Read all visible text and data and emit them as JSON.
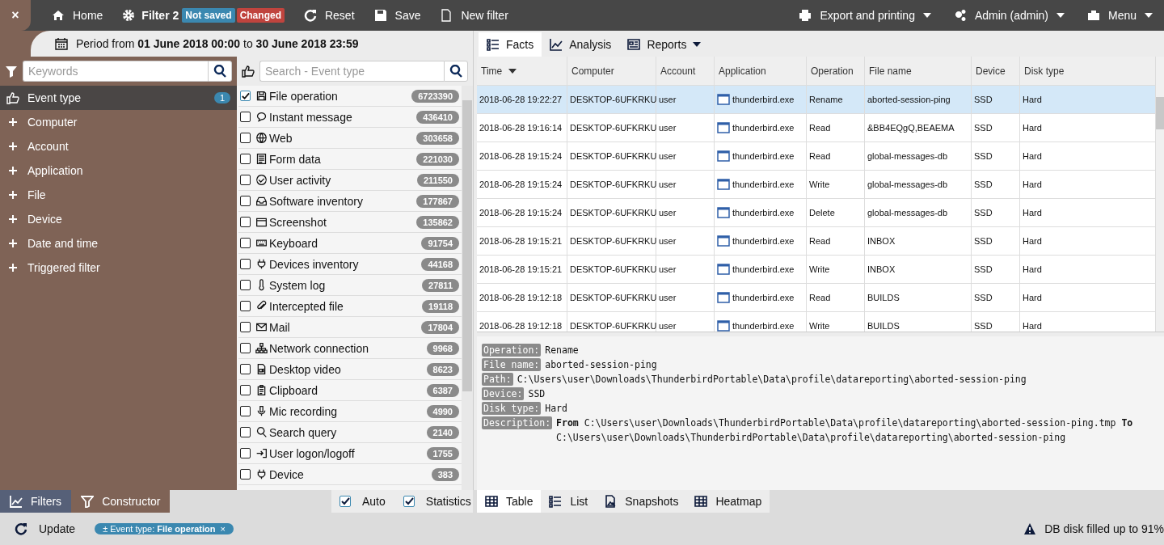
{
  "topbar": {
    "close": "×",
    "home": "Home",
    "filter_name": "Filter 2",
    "badges": [
      {
        "label": "Not saved",
        "color": "#3b88b0"
      },
      {
        "label": "Changed",
        "color": "#c0443e"
      }
    ],
    "actions": [
      "Reset",
      "Save",
      "New filter"
    ],
    "right": [
      {
        "label": "Export and printing",
        "kind": "export"
      },
      {
        "label": "Admin (admin)",
        "kind": "user"
      },
      {
        "label": "Menu",
        "kind": "menu"
      }
    ]
  },
  "period": "Period from **01 June 2018 00:00** to **30 June 2018 23:59**",
  "sidebar": {
    "search": {
      "placeholder": "Keywords"
    },
    "items": [
      {
        "label": "Event type",
        "selected": true,
        "badge": "1"
      },
      {
        "label": "Computer",
        "selected": false
      },
      {
        "label": "Account",
        "selected": false
      },
      {
        "label": "Application",
        "selected": false
      },
      {
        "label": "File",
        "selected": false
      },
      {
        "label": "Device",
        "selected": false
      },
      {
        "label": "Date and time",
        "selected": false
      },
      {
        "label": "Triggered filter",
        "selected": false
      }
    ]
  },
  "event_types": {
    "search": {
      "placeholder": "Search - Event type"
    },
    "items": [
      {
        "label": "File operation",
        "count": "6723390",
        "checked": true,
        "kind": "floppy"
      },
      {
        "label": "Instant message",
        "count": "436410",
        "checked": false,
        "kind": "chat"
      },
      {
        "label": "Web",
        "count": "303658",
        "checked": false,
        "kind": "globe"
      },
      {
        "label": "Form data",
        "count": "221030",
        "checked": false,
        "kind": "form"
      },
      {
        "label": "User activity",
        "count": "211550",
        "checked": false,
        "kind": "checkcircle"
      },
      {
        "label": "Software inventory",
        "count": "177867",
        "checked": false,
        "kind": "inbox"
      },
      {
        "label": "Screenshot",
        "count": "135862",
        "checked": false,
        "kind": "window"
      },
      {
        "label": "Keyboard",
        "count": "91754",
        "checked": false,
        "kind": "keyboard"
      },
      {
        "label": "Devices inventory",
        "count": "44168",
        "checked": false,
        "kind": "plug"
      },
      {
        "label": "System log",
        "count": "27811",
        "checked": false,
        "kind": "thermometer"
      },
      {
        "label": "Intercepted file",
        "count": "19118",
        "checked": false,
        "kind": "paperclip"
      },
      {
        "label": "Mail",
        "count": "17804",
        "checked": false,
        "kind": "envelope"
      },
      {
        "label": "Network connection",
        "count": "9968",
        "checked": false,
        "kind": "sitemap"
      },
      {
        "label": "Desktop video",
        "count": "8623",
        "checked": false,
        "kind": "video"
      },
      {
        "label": "Clipboard",
        "count": "6387",
        "checked": false,
        "kind": "clipboard"
      },
      {
        "label": "Mic recording",
        "count": "4990",
        "checked": false,
        "kind": "mic"
      },
      {
        "label": "Search query",
        "count": "2140",
        "checked": false,
        "kind": "search"
      },
      {
        "label": "User logon/logoff",
        "count": "1755",
        "checked": false,
        "kind": "signin"
      },
      {
        "label": "Device",
        "count": "383",
        "checked": false,
        "kind": "plug"
      }
    ]
  },
  "view_tabs": [
    {
      "label": "Facts",
      "selected": true,
      "kind": "list"
    },
    {
      "label": "Analysis",
      "selected": false,
      "kind": "chart"
    },
    {
      "label": "Reports",
      "selected": false,
      "kind": "report"
    }
  ],
  "table": {
    "columns": [
      {
        "label": "Time",
        "sorted": true
      },
      {
        "label": "Computer",
        "sorted": false
      },
      {
        "label": "Account",
        "sorted": false
      },
      {
        "label": "Application",
        "sorted": false
      },
      {
        "label": "Operation",
        "sorted": false
      },
      {
        "label": "File name",
        "sorted": false
      },
      {
        "label": "Device",
        "sorted": false
      },
      {
        "label": "Disk type",
        "sorted": false
      }
    ],
    "rows": [
      {
        "selected": true,
        "cells": [
          "2018-06-28 19:22:27",
          "DESKTOP-6UFKRKU",
          "user",
          "thunderbird.exe",
          "Rename",
          "aborted-session-ping",
          "SSD",
          "Hard"
        ]
      },
      {
        "selected": false,
        "cells": [
          "2018-06-28 19:16:14",
          "DESKTOP-6UFKRKU",
          "user",
          "thunderbird.exe",
          "Read",
          "&BB4EQgQ,BEAEMA",
          "SSD",
          "Hard"
        ]
      },
      {
        "selected": false,
        "cells": [
          "2018-06-28 19:15:24",
          "DESKTOP-6UFKRKU",
          "user",
          "thunderbird.exe",
          "Read",
          "global-messages-db",
          "SSD",
          "Hard"
        ]
      },
      {
        "selected": false,
        "cells": [
          "2018-06-28 19:15:24",
          "DESKTOP-6UFKRKU",
          "user",
          "thunderbird.exe",
          "Write",
          "global-messages-db",
          "SSD",
          "Hard"
        ]
      },
      {
        "selected": false,
        "cells": [
          "2018-06-28 19:15:24",
          "DESKTOP-6UFKRKU",
          "user",
          "thunderbird.exe",
          "Delete",
          "global-messages-db",
          "SSD",
          "Hard"
        ]
      },
      {
        "selected": false,
        "cells": [
          "2018-06-28 19:15:21",
          "DESKTOP-6UFKRKU",
          "user",
          "thunderbird.exe",
          "Read",
          "INBOX",
          "SSD",
          "Hard"
        ]
      },
      {
        "selected": false,
        "cells": [
          "2018-06-28 19:15:21",
          "DESKTOP-6UFKRKU",
          "user",
          "thunderbird.exe",
          "Write",
          "INBOX",
          "SSD",
          "Hard"
        ]
      },
      {
        "selected": false,
        "cells": [
          "2018-06-28 19:12:18",
          "DESKTOP-6UFKRKU",
          "user",
          "thunderbird.exe",
          "Read",
          "BUILDS",
          "SSD",
          "Hard"
        ]
      },
      {
        "selected": false,
        "cells": [
          "2018-06-28 19:12:18",
          "DESKTOP-6UFKRKU",
          "user",
          "thunderbird.exe",
          "Write",
          "BUILDS",
          "SSD",
          "Hard"
        ]
      }
    ]
  },
  "details": [
    {
      "label": "Operation:",
      "value": "Rename"
    },
    {
      "label": "File name:",
      "value": "aborted-session-ping"
    },
    {
      "label": "Path:",
      "value": "C:\\Users\\user\\Downloads\\ThunderbirdPortable\\Data\\profile\\datareporting\\aborted-session-ping"
    },
    {
      "label": "Device:",
      "value": "SSD"
    },
    {
      "label": "Disk type:",
      "value": "Hard"
    },
    {
      "label": "Description:",
      "value": "**From** C:\\Users\\user\\Downloads\\ThunderbirdPortable\\Data\\profile\\datareporting\\aborted-session-ping.tmp **To** C:\\Users\\user\\Downloads\\ThunderbirdPortable\\Data\\profile\\datareporting\\aborted-session-ping"
    }
  ],
  "left_tabs": [
    {
      "label": "Filters",
      "selected": true,
      "kind": "chart"
    },
    {
      "label": "Constructor",
      "selected": false,
      "kind": "funnel"
    }
  ],
  "options": [
    {
      "label": "Auto",
      "checked": true
    },
    {
      "label": "Statistics",
      "checked": true
    }
  ],
  "bottom_tabs": [
    {
      "label": "Table",
      "selected": true,
      "kind": "table"
    },
    {
      "label": "List",
      "selected": false,
      "kind": "list"
    },
    {
      "label": "Snapshots",
      "selected": false,
      "kind": "image"
    },
    {
      "label": "Heatmap",
      "selected": false,
      "kind": "table"
    }
  ],
  "status_bar": {
    "update": "Update",
    "chip": "± Event type: **File operation**",
    "chip_close": "×",
    "warning": "DB disk filled up to 91%"
  }
}
